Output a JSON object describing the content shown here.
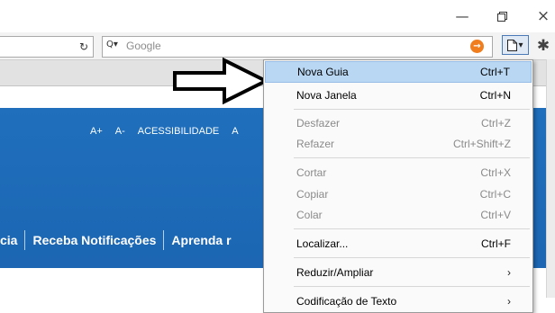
{
  "window_controls": {
    "minimize": "—",
    "restore": "",
    "close": "×"
  },
  "toolbar": {
    "reload_icon": "↻",
    "search": {
      "placeholder": "Google",
      "engine_icon": "Q▾",
      "go_icon": "→"
    },
    "page_button_icon": "page-icon",
    "page_button_caret": "▾",
    "settings_icon": "✱"
  },
  "site": {
    "access_links": [
      "A+",
      "A-",
      "ACESSIBILIDADE",
      "A"
    ],
    "nav": [
      "cia",
      "Receba Notificações",
      "Aprenda r"
    ]
  },
  "menu": {
    "items": [
      {
        "label": "Nova Guia",
        "shortcut": "Ctrl+T"
      },
      {
        "label": "Nova Janela",
        "shortcut": "Ctrl+N"
      },
      {
        "label": "Desfazer",
        "shortcut": "Ctrl+Z"
      },
      {
        "label": "Refazer",
        "shortcut": "Ctrl+Shift+Z"
      },
      {
        "label": "Cortar",
        "shortcut": "Ctrl+X"
      },
      {
        "label": "Copiar",
        "shortcut": "Ctrl+C"
      },
      {
        "label": "Colar",
        "shortcut": "Ctrl+V"
      },
      {
        "label": "Localizar...",
        "shortcut": "Ctrl+F"
      },
      {
        "label": "Reduzir/Ampliar",
        "shortcut": "›"
      },
      {
        "label": "Codificação de Texto",
        "shortcut": "›"
      }
    ]
  },
  "colors": {
    "header_blue": "#1f6fbd",
    "menu_highlight": "#b9d7f3",
    "search_go": "#f07d1e"
  }
}
